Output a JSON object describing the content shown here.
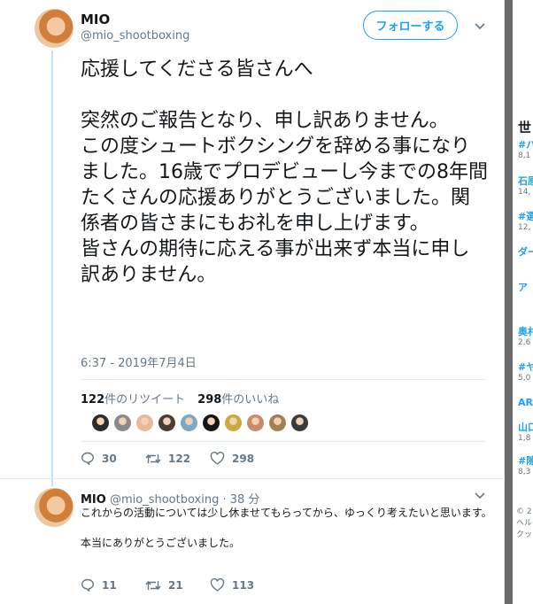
{
  "tweet": {
    "author_name": "MIO",
    "author_handle": "@mio_shootboxing",
    "follow_label": "フォローする",
    "text": "応援してくださる皆さんへ\n\n突然のご報告となり、申し訳ありません。\nこの度シュートボクシングを辞める事になりました。16歳でプロデビューし今までの8年間たくさんの応援ありがとうございました。関係者の皆さまにもお礼を申し上げます。\n皆さんの期待に応える事が出来ず本当に申し訳ありません。",
    "timestamp": "6:37 - 2019年7月4日",
    "retweets_count": "122",
    "retweets_label": "件のリツイート",
    "likes_count": "298",
    "likes_label": "件のいいね",
    "likers": [
      "#2b2b2b",
      "#8a8a8a",
      "#e7b89a",
      "#4a3d35",
      "#7da7c8",
      "#141414",
      "#c9aa3c",
      "#c58b6a",
      "#a3804f",
      "#3a3a3a"
    ],
    "actions": {
      "replies": "30",
      "retweets": "122",
      "likes": "298"
    }
  },
  "reply": {
    "author_name": "MIO",
    "author_handle": "@mio_shootboxing",
    "time": "38 分",
    "text": "これからの活動については少し休ませてもらってから、ゆっくり考えたいと思います。\n\n本当にありがとうございました。",
    "actions": {
      "replies": "11",
      "retweets": "21",
      "likes": "113"
    }
  },
  "sidebar": {
    "heading": "世",
    "items": [
      {
        "title": "#パ",
        "count": "8,1"
      },
      {
        "title": "石原",
        "count": "14,"
      },
      {
        "title": "#選",
        "count": "12,"
      },
      {
        "title": "ダー",
        "count": ""
      },
      {
        "title": "ア",
        "count": ""
      },
      {
        "title": "奥村",
        "count": "2,6"
      },
      {
        "title": "#ヤ",
        "count": "5,0"
      },
      {
        "title": "AR",
        "count": ""
      },
      {
        "title": "山口",
        "count": "1,8"
      },
      {
        "title": "#隙",
        "count": "8,3"
      }
    ],
    "footer": "© 2\nヘル\nクッ"
  },
  "colors": {
    "accent": "#1da1f2",
    "thread": "#c4e4f9",
    "muted": "#657786"
  }
}
